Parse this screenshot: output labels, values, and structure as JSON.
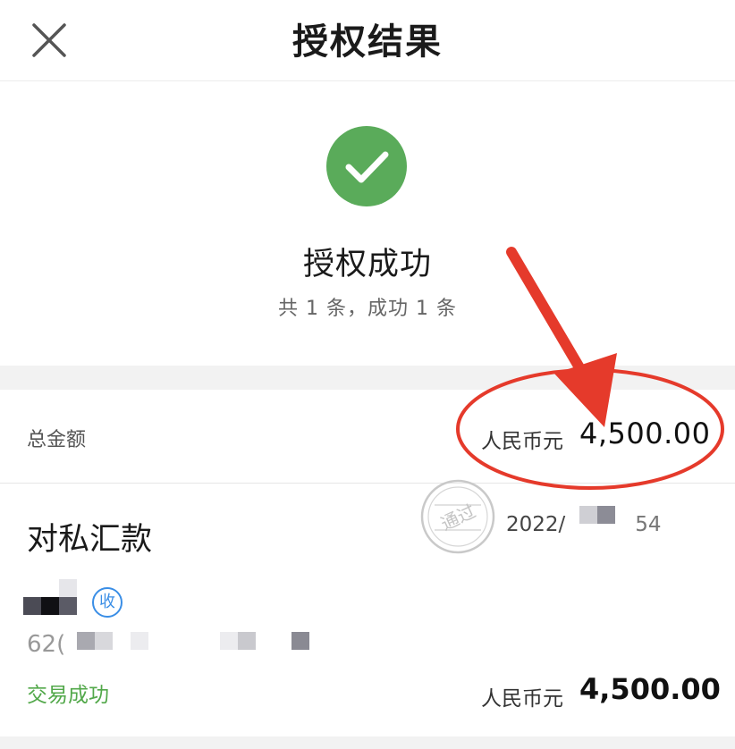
{
  "header": {
    "title": "授权结果",
    "close_icon": "close-icon"
  },
  "result": {
    "icon": "check-circle-icon",
    "icon_color": "#5aab5a",
    "title": "授权成功",
    "summary": "共 1 条，成功 1 条"
  },
  "total": {
    "label": "总金额",
    "currency": "人民币元",
    "amount": "4,500.00"
  },
  "transaction": {
    "type": "对私汇款",
    "date": "2022/",
    "date_tail": "54",
    "badge": "收",
    "account_prefix": "62(",
    "status": "交易成功",
    "status_color": "#52a84a",
    "currency": "人民币元",
    "amount": "4,500.00",
    "stamp_text": "通过"
  },
  "annotation": {
    "color": "#e53a2b"
  }
}
